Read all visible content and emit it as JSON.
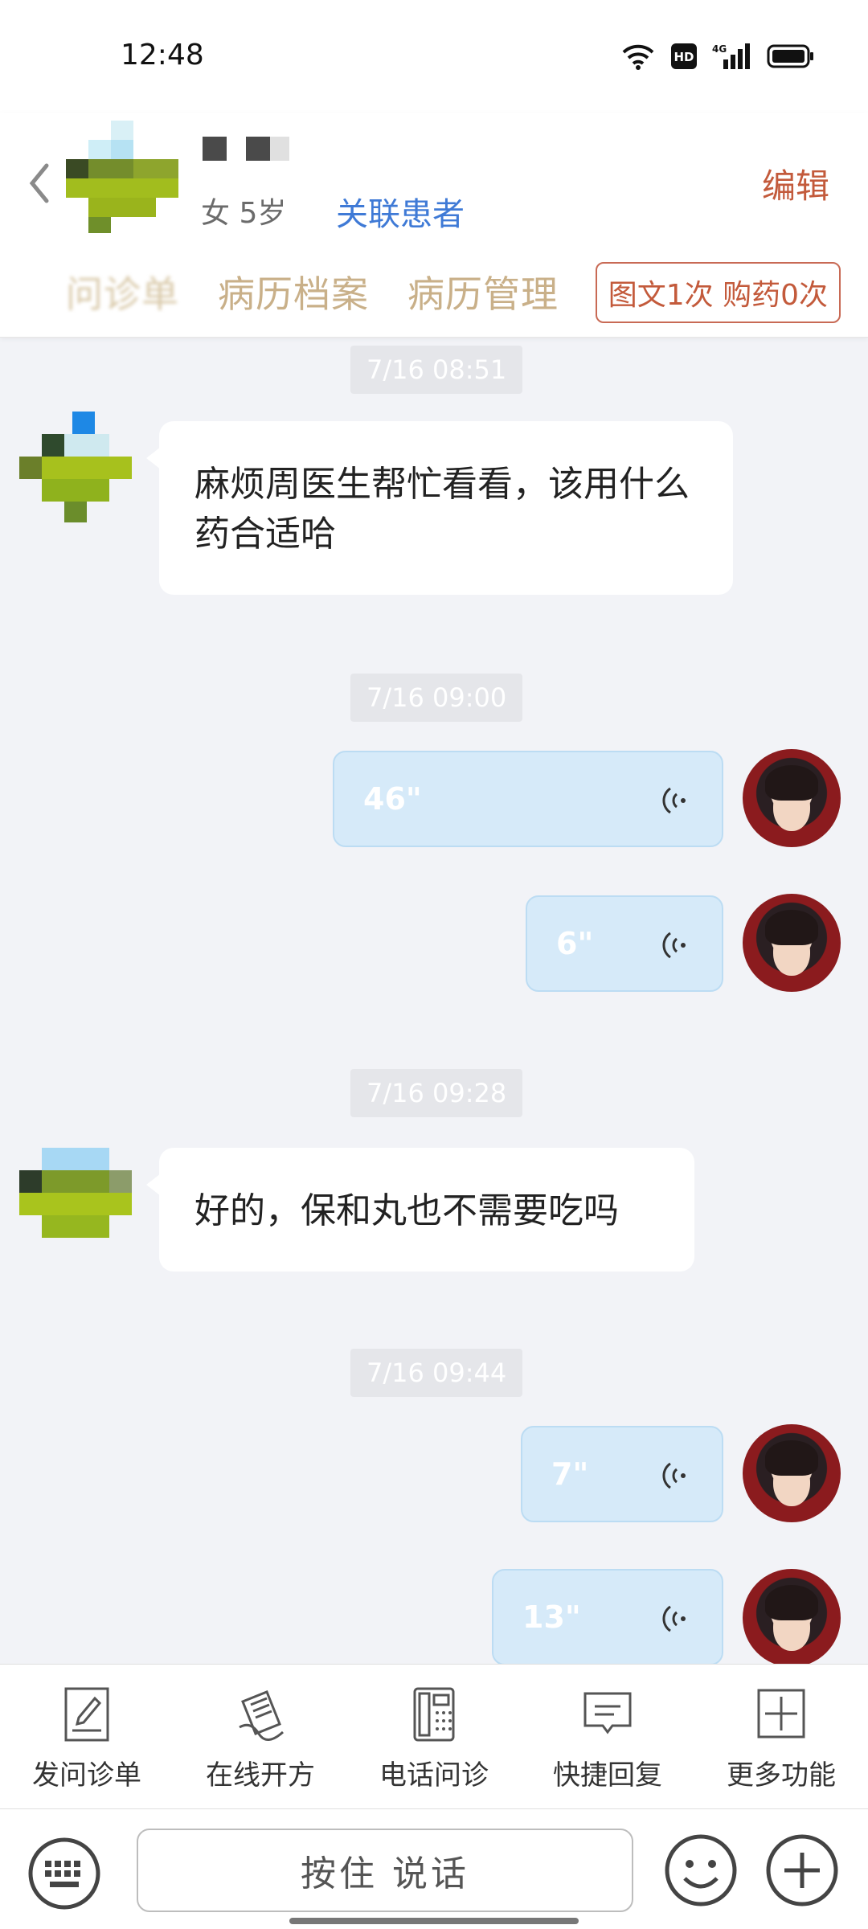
{
  "status_bar": {
    "time": "12:48",
    "network": "4G"
  },
  "header": {
    "patient_meta": "女 5岁",
    "link_patient": "关联患者",
    "edit": "编辑",
    "tabs": [
      {
        "label": "问诊单"
      },
      {
        "label": "病历档案"
      },
      {
        "label": "病历管理"
      }
    ],
    "quota": "图文1次 购药0次"
  },
  "chat": {
    "messages": [
      {
        "type": "time",
        "text": "7/16 08:51"
      },
      {
        "type": "text_in",
        "text": "麻烦周医生帮忙看看，该用什么药合适哈"
      },
      {
        "type": "time",
        "text": "7/16 09:00"
      },
      {
        "type": "voice_out",
        "duration": "46\""
      },
      {
        "type": "voice_out",
        "duration": "6\""
      },
      {
        "type": "time",
        "text": "7/16 09:28"
      },
      {
        "type": "text_in",
        "text": "好的，保和丸也不需要吃吗"
      },
      {
        "type": "time",
        "text": "7/16 09:44"
      },
      {
        "type": "voice_out",
        "duration": "7\""
      },
      {
        "type": "voice_out",
        "duration": "13\""
      }
    ]
  },
  "toolbar": {
    "items": [
      {
        "label": "发问诊单",
        "icon": "form-icon"
      },
      {
        "label": "在线开方",
        "icon": "prescription-icon"
      },
      {
        "label": "电话问诊",
        "icon": "phone-icon"
      },
      {
        "label": "快捷回复",
        "icon": "quick-reply-icon"
      },
      {
        "label": "更多功能",
        "icon": "more-icon"
      }
    ]
  },
  "input_bar": {
    "hold_to_talk": "按住 说话"
  }
}
